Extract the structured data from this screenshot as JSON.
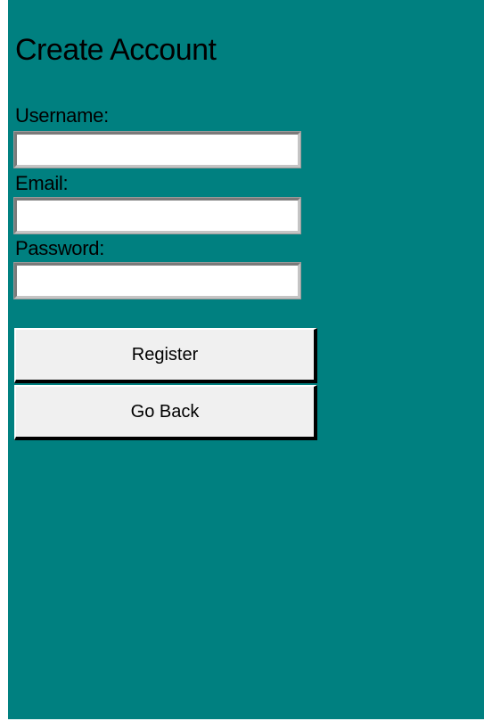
{
  "form": {
    "title": "Create Account",
    "fields": [
      {
        "label": "Username:",
        "value": "",
        "placeholder": ""
      },
      {
        "label": "Email:",
        "value": "",
        "placeholder": ""
      },
      {
        "label": "Password:",
        "value": "",
        "placeholder": ""
      }
    ]
  },
  "buttons": {
    "register_label": "Register",
    "back_label": "Go Back"
  },
  "colors": {
    "background": "#008080",
    "button_face": "#f0f0f0",
    "input_background": "#ffffff"
  }
}
